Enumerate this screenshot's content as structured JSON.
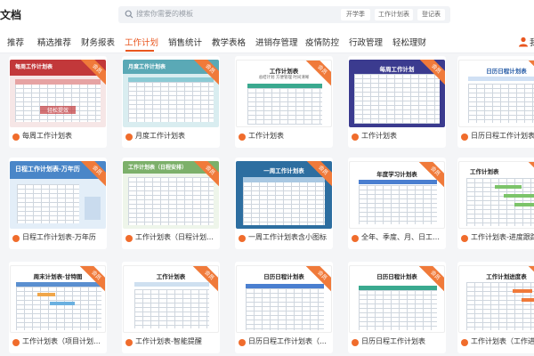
{
  "header": {
    "brand": "文档",
    "search_placeholder": "搜索你需要的模板",
    "chips": [
      "开学季",
      "工作计划表",
      "登记表"
    ]
  },
  "nav": {
    "items": [
      "推荐",
      "精选推荐",
      "财务报表",
      "工作计划",
      "销售统计",
      "教学表格",
      "进销存管理",
      "疫情防控",
      "行政管理",
      "轻松理财"
    ],
    "active_index": 3,
    "user_label": "我"
  },
  "ribbon_label": "会员",
  "cards": [
    {
      "title": "每周工作计划表",
      "thumb_title": "每周工作计划表",
      "thumb_overlay": "轻松提效"
    },
    {
      "title": "月度工作计划表",
      "thumb_title": "月度工作计划表"
    },
    {
      "title": "工作计划表",
      "thumb_title": "工作计划表",
      "thumb_sub": "总结计划 方便管理 时间清晰"
    },
    {
      "title": "工作计划表",
      "thumb_title": "每周工作计划"
    },
    {
      "title": "日历日程工作计划表",
      "thumb_title": "日历日程计划表"
    },
    {
      "title": "日程工作计划表-万年历",
      "thumb_title": "日程工作计划表-万年历"
    },
    {
      "title": "工作计划表（日程计划表）",
      "thumb_title": "工作计划表（日程安排）"
    },
    {
      "title": "一周工作计划表含小图标",
      "thumb_title": "一周工作计划表"
    },
    {
      "title": "全年、季度、月、日工作…",
      "thumb_title": "年度学习计划表"
    },
    {
      "title": "工作计划表-进度跟踪",
      "thumb_title": "工作计划表"
    },
    {
      "title": "工作计划表（项目计划甘…",
      "thumb_title": "周末计划表-甘特图"
    },
    {
      "title": "工作计划表-智能提醒",
      "thumb_title": "工作计划表"
    },
    {
      "title": "日历日程工作计划表（全…",
      "thumb_title": "日历日程计划表"
    },
    {
      "title": "日历日程工作计划表",
      "thumb_title": "日历日程计划表"
    },
    {
      "title": "工作计划表（工作进度…",
      "thumb_title": "工作计划进度表"
    }
  ],
  "colors": {
    "accent": "#e9561f",
    "ribbon": "#f07a3a"
  }
}
